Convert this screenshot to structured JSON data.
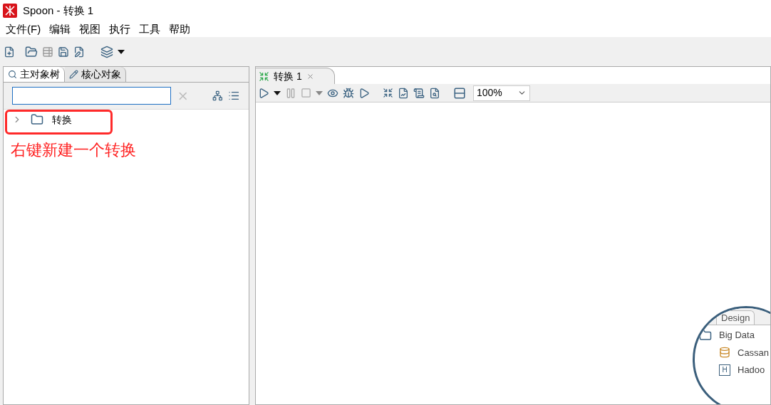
{
  "window": {
    "title": "Spoon - 转换 1"
  },
  "menu": [
    "文件(F)",
    "编辑",
    "视图",
    "执行",
    "工具",
    "帮助"
  ],
  "left_panel": {
    "tabs": [
      {
        "label": "主对象树",
        "selected": true
      },
      {
        "label": "核心对象",
        "selected": false
      }
    ],
    "tree": [
      {
        "label": "转换",
        "expanded": false
      }
    ],
    "annotation": "右键新建一个转换"
  },
  "editor": {
    "tabs": [
      {
        "label": "转换 1",
        "selected": true
      }
    ],
    "zoom": "100%",
    "hint": {
      "tab": "Design",
      "items": [
        {
          "label": "Big Data",
          "kind": "folder"
        },
        {
          "label": "Cassan",
          "kind": "database"
        },
        {
          "label": "Hadoo",
          "kind": "hadoop",
          "icon_text": "H"
        }
      ]
    }
  }
}
